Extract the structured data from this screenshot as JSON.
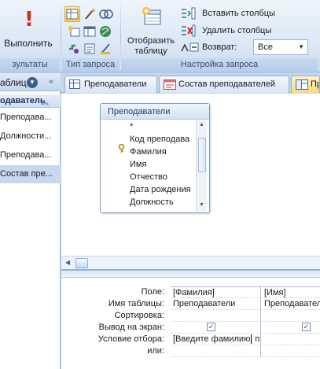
{
  "ribbon": {
    "run_button": {
      "label": "Выполнить",
      "icon": "exclamation-icon"
    },
    "groups": {
      "results": "зультаты",
      "query_type": "Тип запроса",
      "query_setup": "Настройка запроса"
    },
    "show_table_button": {
      "line1": "Отобразить",
      "line2": "таблицу",
      "icon": "table-add-icon"
    },
    "insert_columns": "Вставить столбцы",
    "delete_columns": "Удалить столбцы",
    "return_label": "Возврат:",
    "return_value": "Все"
  },
  "nav_pane": {
    "title": "аблиц",
    "group": "одаватель",
    "items": [
      "Преподава...",
      "Должности...",
      "Преподава...",
      "Состав пре..."
    ],
    "selected_index": 3
  },
  "tabs": [
    "Преподаватели",
    "Состав преподавателей",
    "Пр"
  ],
  "active_tab_index": 2,
  "field_list": {
    "title": "Преподаватели",
    "fields": [
      "*",
      "Код преподава",
      "Фамилия",
      "Имя",
      "Отчество",
      "Дата рождения",
      "Должность"
    ],
    "key_field_index": 1
  },
  "qbe_grid": {
    "row_labels": [
      "Поле:",
      "Имя таблицы:",
      "Сортировка:",
      "Вывод на экран:",
      "Условие отбора:",
      "или:"
    ],
    "columns": [
      {
        "field": "[Фамилия]",
        "table": "Преподаватели",
        "sort": "",
        "show": true,
        "criteria": "[Введите фамилию п",
        "or": ""
      },
      {
        "field": "[Имя]",
        "table": "Преподавател",
        "sort": "",
        "show": true,
        "criteria": "",
        "or": ""
      }
    ]
  },
  "colors": {
    "ribbon_bg": "#dce8f6",
    "frame": "#c4d6ec",
    "active_tab": "#ffd77a",
    "run_icon": "#d8281c",
    "selected_nav": "#c7d9ee"
  }
}
